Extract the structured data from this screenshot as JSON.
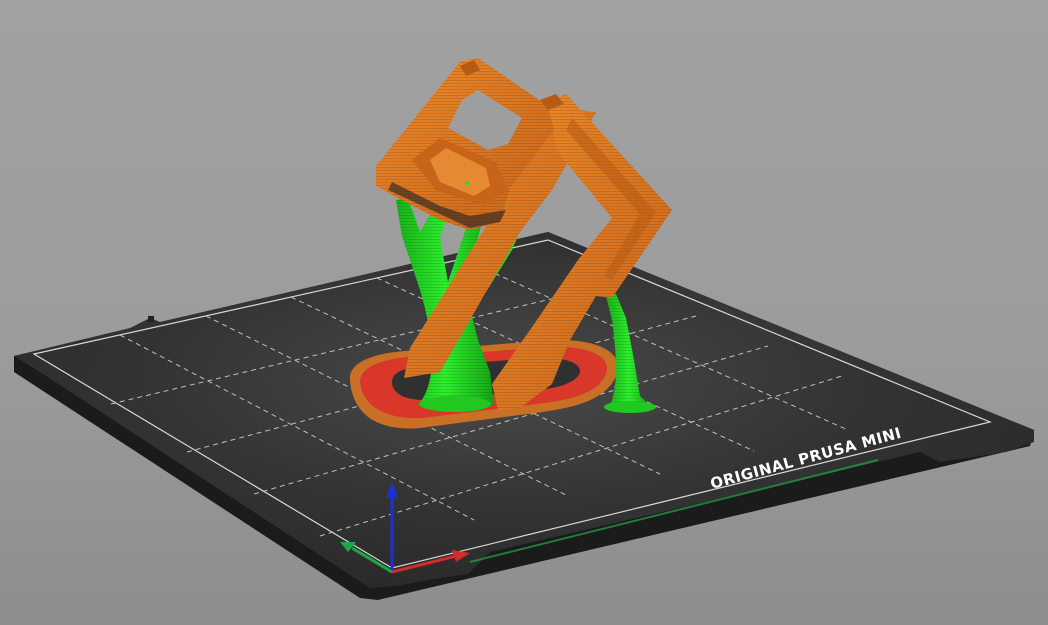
{
  "viewport": {
    "bed_label": "ORIGINAL PRUSA MINI"
  },
  "colors": {
    "background": "#9e9e9e",
    "bed": "#2e2e2e",
    "bed_edge": "#1b1b1b",
    "bed_border": "#d8d8d8",
    "grid": "#bfbfbf",
    "perimeter": "#e07a1f",
    "perimeter_shade": "#b85a12",
    "support": "#22dd22",
    "support_shade": "#14a514",
    "first_layer": "#d8372a",
    "axis_x": "#d42a2a",
    "axis_y": "#1ea84a",
    "axis_z": "#1f2fd8"
  },
  "icons": {
    "axes": "axes-gizmo-icon"
  }
}
